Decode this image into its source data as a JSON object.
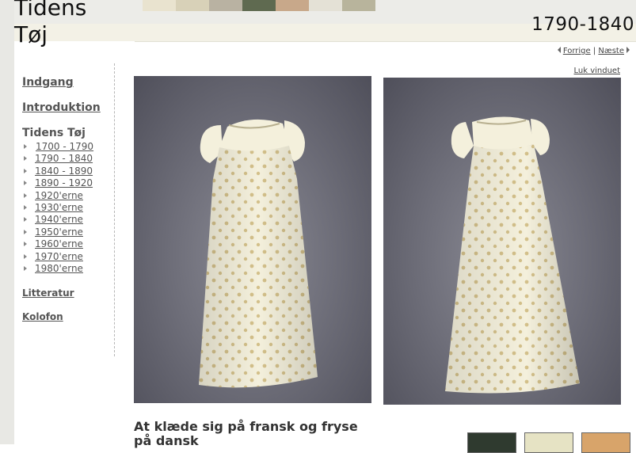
{
  "header": {
    "title_line1": "Tidens",
    "title_line2": "Tøj",
    "period": "1790-1840",
    "strip_colors": [
      "#e9e3cf",
      "#d8d1b8",
      "#b9b2a2",
      "#5f6a50",
      "#c8a88a",
      "#e4e1d6",
      "#b8b49c"
    ]
  },
  "topnav": {
    "prev_label": "Forrige",
    "separator": "|",
    "next_label": "Næste",
    "close_label": "Luk vinduet"
  },
  "sidebar": {
    "entrance": "Indgang",
    "intro": "Introduktion",
    "section_title": "Tidens Tøj",
    "periods": [
      {
        "label": "1700 - 1790"
      },
      {
        "label": "1790 - 1840"
      },
      {
        "label": "1840 - 1890"
      },
      {
        "label": "1890 - 1920"
      },
      {
        "label": "1920'erne"
      },
      {
        "label": "1930'erne"
      },
      {
        "label": "1940'erne"
      },
      {
        "label": "1950'erne"
      },
      {
        "label": "1960'erne"
      },
      {
        "label": "1970'erne"
      },
      {
        "label": "1980'erne"
      }
    ],
    "literature": "Litteratur",
    "colophon": "Kolofon"
  },
  "main": {
    "caption": "At klæde sig på fransk og fryse på dansk",
    "photo_colors": {
      "background": "#6d6d78",
      "dress": "#f4f0dc",
      "dots": "#d3c08a"
    },
    "thumb_colors": [
      "#2f3a2f",
      "#e6e3c4",
      "#d8a46a"
    ]
  }
}
